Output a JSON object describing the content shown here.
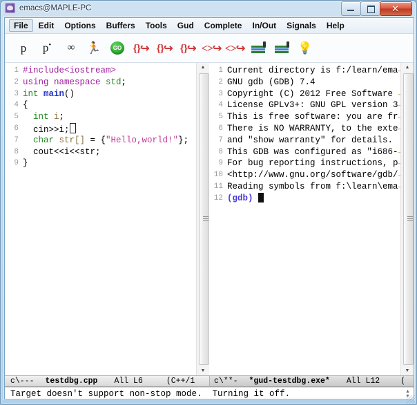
{
  "window": {
    "title": "emacs@MAPLE-PC",
    "app_icon": "emacs-icon",
    "minimize_label": "",
    "maximize_label": "",
    "close_label": "✕"
  },
  "menubar": {
    "items": [
      {
        "label": "File",
        "selected": true
      },
      {
        "label": "Edit",
        "selected": false
      },
      {
        "label": "Options",
        "selected": false
      },
      {
        "label": "Buffers",
        "selected": false
      },
      {
        "label": "Tools",
        "selected": false
      },
      {
        "label": "Gud",
        "selected": false
      },
      {
        "label": "Complete",
        "selected": false
      },
      {
        "label": "In/Out",
        "selected": false
      },
      {
        "label": "Signals",
        "selected": false
      },
      {
        "label": "Help",
        "selected": false
      }
    ]
  },
  "toolbar": {
    "buttons": [
      {
        "name": "print-icon",
        "glyph": "p"
      },
      {
        "name": "print-star-icon",
        "glyph": "p*"
      },
      {
        "name": "watch-icon",
        "glyph": "66"
      },
      {
        "name": "run-icon",
        "glyph": "run"
      },
      {
        "name": "go-icon",
        "glyph": "GO"
      },
      {
        "name": "step-into-icon",
        "glyph": "{}"
      },
      {
        "name": "step-over-icon",
        "glyph": "{}"
      },
      {
        "name": "step-out-icon",
        "glyph": "{}"
      },
      {
        "name": "next-instr-icon",
        "glyph": "<>"
      },
      {
        "name": "step-instr-icon",
        "glyph": "<>"
      },
      {
        "name": "up-stack-icon",
        "glyph": "stack"
      },
      {
        "name": "down-stack-icon",
        "glyph": "stack"
      },
      {
        "name": "lamp-icon",
        "glyph": "bulb"
      }
    ]
  },
  "source_pane": {
    "buffer_name": "testdbg.cpp",
    "lines": [
      {
        "n": "1",
        "tokens": [
          {
            "t": "#include<iostream>",
            "f": "f-pre"
          }
        ]
      },
      {
        "n": "2",
        "tokens": [
          {
            "t": "using namespace ",
            "f": "f-pre"
          },
          {
            "t": "std",
            "f": "f-kw"
          },
          {
            "t": ";",
            "f": "f-plain"
          }
        ]
      },
      {
        "n": "3",
        "tokens": [
          {
            "t": "int ",
            "f": "f-kw"
          },
          {
            "t": "main",
            "f": "f-fn"
          },
          {
            "t": "()",
            "f": "f-plain"
          }
        ]
      },
      {
        "n": "4",
        "tokens": [
          {
            "t": "{",
            "f": "f-plain"
          }
        ]
      },
      {
        "n": "5",
        "tokens": [
          {
            "t": "  int ",
            "f": "f-kw"
          },
          {
            "t": "i",
            "f": "f-var"
          },
          {
            "t": ";",
            "f": "f-plain"
          }
        ]
      },
      {
        "n": "6",
        "tokens": [
          {
            "t": "  cin>>i;",
            "f": "f-plain"
          },
          {
            "t": "CURSOR_BOX",
            "f": "cursor"
          }
        ]
      },
      {
        "n": "7",
        "tokens": [
          {
            "t": "  char ",
            "f": "f-kw"
          },
          {
            "t": "str[]",
            "f": "f-var"
          },
          {
            "t": " = {",
            "f": "f-plain"
          },
          {
            "t": "\"Hello,world!\"",
            "f": "f-str"
          },
          {
            "t": "};",
            "f": "f-plain"
          }
        ]
      },
      {
        "n": "8",
        "tokens": [
          {
            "t": "  cout<<i<<str;",
            "f": "f-plain"
          }
        ]
      },
      {
        "n": "9",
        "tokens": [
          {
            "t": "}",
            "f": "f-plain"
          }
        ]
      }
    ]
  },
  "gdb_pane": {
    "buffer_name": "*gud-testdbg.exe*",
    "lines": [
      {
        "n": "1",
        "tokens": [
          {
            "t": "Current directory is f:/learn/ema",
            "f": "f-plain"
          },
          {
            "t": "CONT",
            "f": "cont"
          }
        ]
      },
      {
        "n": "2",
        "tokens": [
          {
            "t": "GNU gdb (GDB) 7.4",
            "f": "f-plain"
          }
        ]
      },
      {
        "n": "3",
        "tokens": [
          {
            "t": "Copyright (C) 2012 Free Software ",
            "f": "f-plain"
          },
          {
            "t": "CONT",
            "f": "cont"
          }
        ]
      },
      {
        "n": "4",
        "tokens": [
          {
            "t": "License GPLv3+: GNU GPL version 3",
            "f": "f-plain"
          },
          {
            "t": "CONT",
            "f": "cont"
          }
        ]
      },
      {
        "n": "5",
        "tokens": [
          {
            "t": "This is free software: you are fr",
            "f": "f-plain"
          },
          {
            "t": "CONT",
            "f": "cont"
          }
        ]
      },
      {
        "n": "6",
        "tokens": [
          {
            "t": "There is NO WARRANTY, to the exte",
            "f": "f-plain"
          },
          {
            "t": "CONT",
            "f": "cont"
          }
        ]
      },
      {
        "n": "7",
        "tokens": [
          {
            "t": "and \"show warranty\" for details.",
            "f": "f-plain"
          }
        ]
      },
      {
        "n": "8",
        "tokens": [
          {
            "t": "This GDB was configured as \"i686-",
            "f": "f-plain"
          },
          {
            "t": "CONT",
            "f": "cont"
          }
        ]
      },
      {
        "n": "9",
        "tokens": [
          {
            "t": "For bug reporting instructions, p",
            "f": "f-plain"
          },
          {
            "t": "CONT",
            "f": "cont"
          }
        ]
      },
      {
        "n": "10",
        "tokens": [
          {
            "t": "<http://www.gnu.org/software/gdb/",
            "f": "f-plain"
          },
          {
            "t": "CONT",
            "f": "cont"
          }
        ]
      },
      {
        "n": "11",
        "tokens": [
          {
            "t": "Reading symbols from f:\\learn\\ema",
            "f": "f-plain"
          },
          {
            "t": "CONT",
            "f": "cont"
          }
        ]
      },
      {
        "n": "12",
        "tokens": [
          {
            "t": "(gdb) ",
            "f": "f-prompt"
          },
          {
            "t": "CURSOR_SOLID",
            "f": "cursor"
          }
        ]
      }
    ]
  },
  "modeline_left": {
    "coding": "c\\---",
    "buffer": "testdbg.cpp",
    "position": "All L6",
    "mode": "(C++/1"
  },
  "modeline_right": {
    "coding": "c\\**-",
    "buffer": "*gud-testdbg.exe*",
    "position": "All L12",
    "mode": "("
  },
  "minibuffer": {
    "message": "Target doesn't support non-stop mode.  Turning it off."
  },
  "colors": {
    "preprocessor": "#a020a0",
    "keyword": "#1f8a1f",
    "function": "#2233cc",
    "variable": "#8a6d3b",
    "string": "#c0389a",
    "prompt": "#4b3bd6",
    "close_button": "#bc3a22",
    "go_badge": "#149914"
  }
}
